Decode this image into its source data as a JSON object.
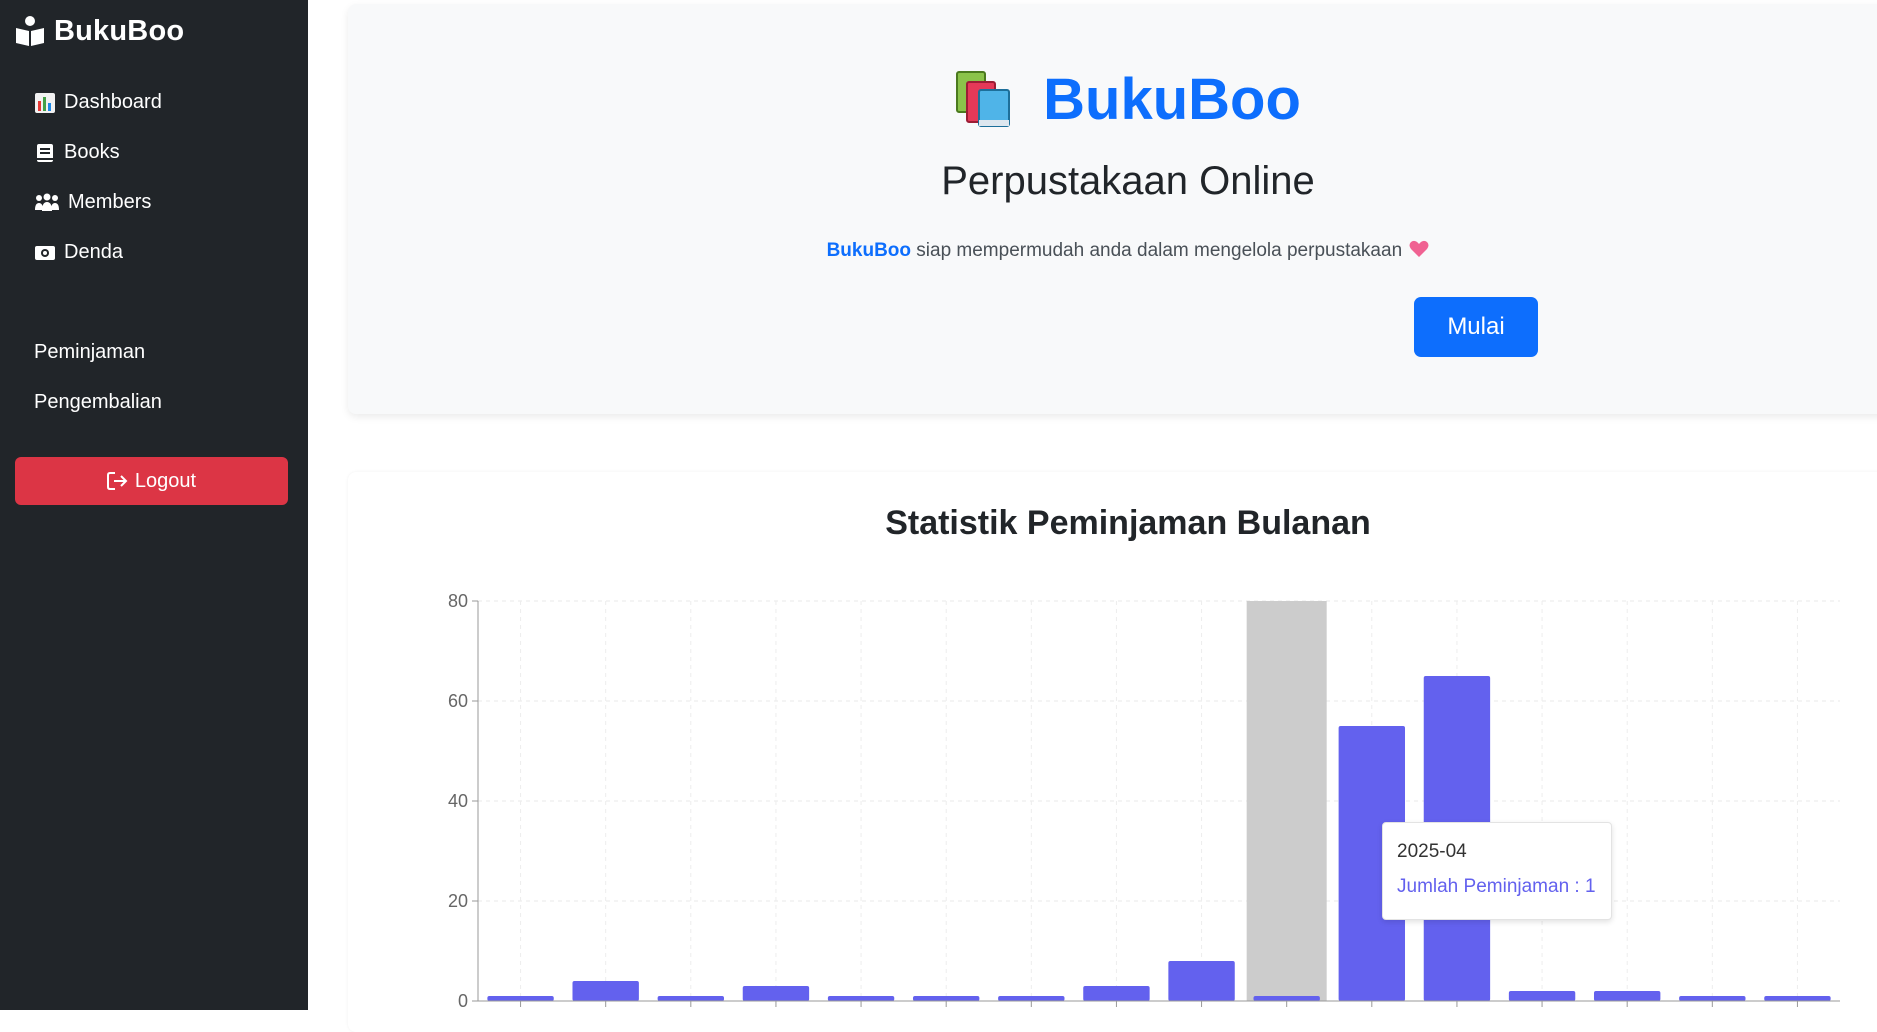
{
  "sidebar": {
    "brand": "BukuBoo",
    "items": [
      {
        "label": "Dashboard",
        "icon": "chart-emoji-icon"
      },
      {
        "label": "Books",
        "icon": "book-icon"
      },
      {
        "label": "Members",
        "icon": "users-icon"
      },
      {
        "label": "Denda",
        "icon": "money-icon"
      }
    ],
    "links": [
      "Peminjaman",
      "Pengembalian"
    ],
    "logout": "Logout"
  },
  "hero": {
    "title": "BukuBoo",
    "subtitle": "Perpustakaan Online",
    "desc_brand": "BukuBoo",
    "desc_text": " siap mempermudah anda dalam mengelola perpustakaan",
    "button": "Mulai"
  },
  "colors": {
    "sidebar_bg": "#212529",
    "primary": "#0d6efd",
    "danger": "#dc3545",
    "bar": "#6361ee",
    "cursor": "#cccccc"
  },
  "chart_data": {
    "type": "bar",
    "title": "Statistik Peminjaman Bulanan",
    "xlabel": "",
    "ylabel": "",
    "yticks": [
      0,
      20,
      40,
      60,
      80
    ],
    "ylim": [
      0,
      80
    ],
    "grid": true,
    "categories": [
      "",
      "",
      "",
      "",
      "",
      "",
      "",
      "",
      "",
      "2025-04",
      "",
      "",
      "",
      "",
      "",
      ""
    ],
    "series": [
      {
        "name": "Jumlah Peminjaman",
        "values": [
          1,
          4,
          1,
          3,
          1,
          1,
          1,
          3,
          8,
          1,
          55,
          65,
          2,
          2,
          1,
          1
        ]
      }
    ],
    "highlight_index": 9
  },
  "tooltip": {
    "label": "2025-04",
    "value_text": "Jumlah Peminjaman : 1"
  }
}
